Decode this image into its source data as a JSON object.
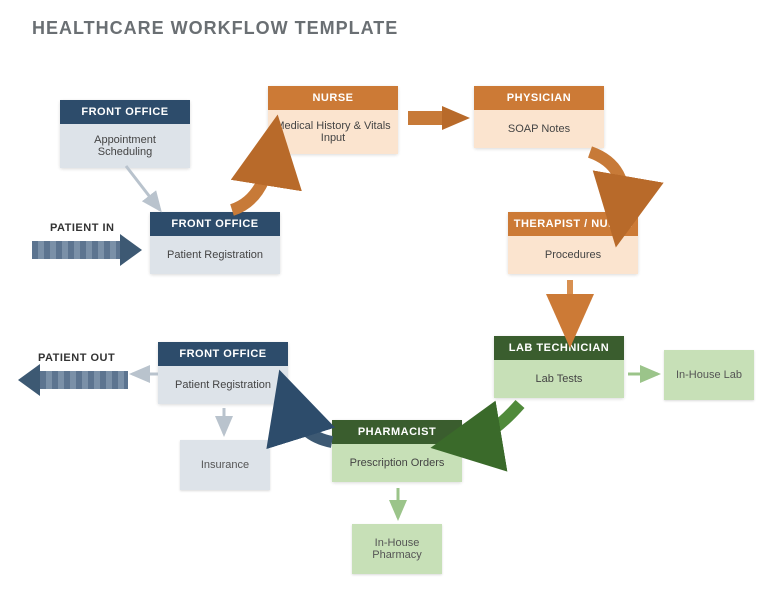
{
  "title": "HEALTHCARE WORKFLOW TEMPLATE",
  "labels": {
    "patient_in": "PATIENT IN",
    "patient_out": "PATIENT OUT"
  },
  "nodes": {
    "fo_appt": {
      "role": "FRONT OFFICE",
      "task": "Appointment Scheduling"
    },
    "fo_reg": {
      "role": "FRONT OFFICE",
      "task": "Patient Registration"
    },
    "nurse": {
      "role": "NURSE",
      "task": "Medical History & Vitals Input"
    },
    "physician": {
      "role": "PHYSICIAN",
      "task": "SOAP Notes"
    },
    "therapist": {
      "role": "THERAPIST / NURSE",
      "task": "Procedures"
    },
    "labtech": {
      "role": "LAB TECHNICIAN",
      "task": "Lab Tests"
    },
    "pharmacist": {
      "role": "PHARMACIST",
      "task": "Prescription Orders"
    },
    "fo_out": {
      "role": "FRONT OFFICE",
      "task": "Patient Registration"
    }
  },
  "aux": {
    "inhouse_lab": "In-House Lab",
    "inhouse_pharmacy": "In-House Pharmacy",
    "insurance": "Insurance"
  }
}
